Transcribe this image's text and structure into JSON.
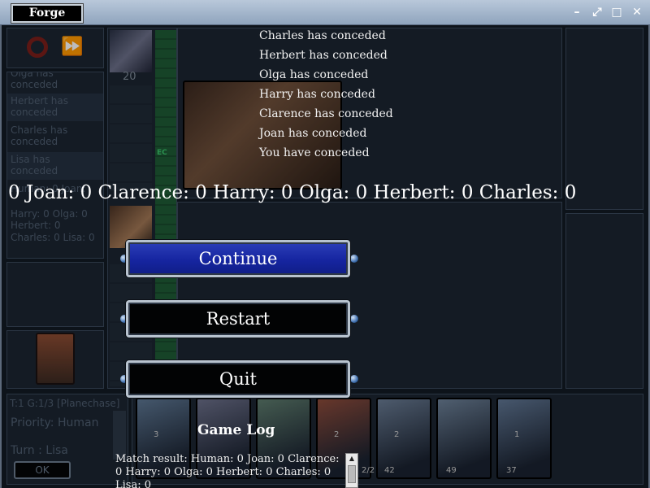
{
  "window": {
    "title": "Forge"
  },
  "left_column": {
    "log_entries": [
      "Olga has conceded",
      "Herbert has conceded",
      "Charles has conceded",
      "Lisa has conceded"
    ],
    "scores_partial": "Human: 0 Joan:",
    "scores_lines": [
      "Harry: 0 Olga: 0",
      "Herbert: 0",
      "Charles: 0 Lisa: 0"
    ]
  },
  "player_top": {
    "life": "20"
  },
  "mana_tag": "EC",
  "status": {
    "turn_info": "T:1 G:1/3 [Planechase]",
    "priority": "Priority: Human",
    "turn": "Turn : Lisa",
    "ok_label": "OK"
  },
  "hand_cards": [
    {
      "name": "card-1",
      "cost": "3",
      "color": "#5c7591"
    },
    {
      "name": "card-2",
      "cost": "",
      "color": "#6a6e88"
    },
    {
      "name": "card-3",
      "cost": "",
      "color": "#5c7a6c"
    },
    {
      "name": "card-4",
      "cost": "2",
      "color": "#8a4a3a"
    },
    {
      "name": "card-5",
      "cost": "2",
      "color": "#687a92"
    },
    {
      "name": "card-6",
      "cost": "",
      "color": "#6b7f96"
    },
    {
      "name": "card-7",
      "cost": "1",
      "color": "#5f7592"
    }
  ],
  "hand_counts": [
    "2/2",
    "42",
    "49",
    "37"
  ],
  "concede_messages": [
    "Charles has conceded",
    "Herbert has conceded",
    "Olga has conceded",
    "Harry has conceded",
    "Clarence has conceded",
    "Joan has conceded",
    "You have conceded"
  ],
  "score_line": "0 Joan: 0 Clarence: 0 Harry: 0 Olga: 0 Herbert: 0 Charles: 0",
  "buttons": {
    "continue": "Continue",
    "restart": "Restart",
    "quit": "Quit"
  },
  "game_log": {
    "title": "Game Log",
    "text": "Match result: Human: 0 Joan: 0 Clarence: 0 Harry: 0 Olga: 0 Herbert: 0 Charles: 0 Lisa: 0"
  }
}
